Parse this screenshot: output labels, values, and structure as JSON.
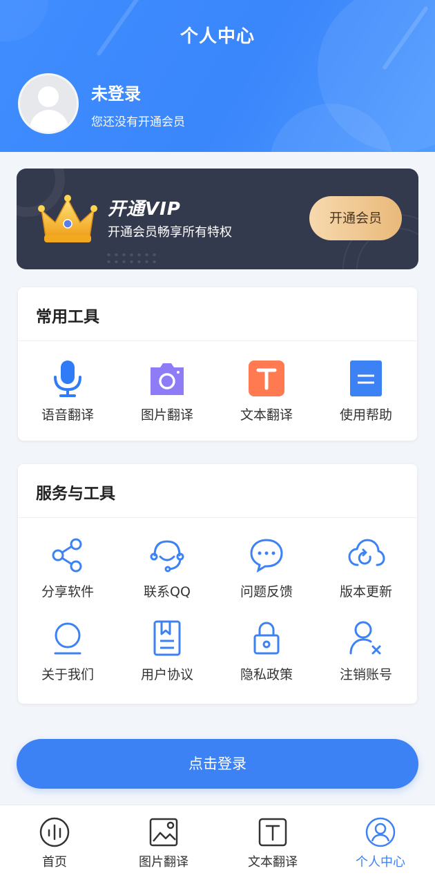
{
  "header": {
    "title": "个人中心",
    "user": {
      "name": "未登录",
      "subtitle": "您还没有开通会员"
    }
  },
  "vip": {
    "title": "开通VIP",
    "subtitle": "开通会员畅享所有特权",
    "button": "开通会员"
  },
  "common_tools": {
    "title": "常用工具",
    "items": [
      {
        "label": "语音翻译",
        "icon": "microphone-icon"
      },
      {
        "label": "图片翻译",
        "icon": "camera-icon"
      },
      {
        "label": "文本翻译",
        "icon": "text-t-icon"
      },
      {
        "label": "使用帮助",
        "icon": "document-icon"
      }
    ]
  },
  "services": {
    "title": "服务与工具",
    "items": [
      {
        "label": "分享软件",
        "icon": "share-icon"
      },
      {
        "label": "联系QQ",
        "icon": "headset-icon"
      },
      {
        "label": "问题反馈",
        "icon": "chat-bubble-icon"
      },
      {
        "label": "版本更新",
        "icon": "cloud-refresh-icon"
      },
      {
        "label": "关于我们",
        "icon": "info-icon"
      },
      {
        "label": "用户协议",
        "icon": "agreement-icon"
      },
      {
        "label": "隐私政策",
        "icon": "lock-icon"
      },
      {
        "label": "注销账号",
        "icon": "user-remove-icon"
      }
    ]
  },
  "login_button": "点击登录",
  "bottom_nav": {
    "items": [
      {
        "label": "首页",
        "icon": "home-audio-icon",
        "active": false
      },
      {
        "label": "图片翻译",
        "icon": "image-icon",
        "active": false
      },
      {
        "label": "文本翻译",
        "icon": "text-t-icon",
        "active": false
      },
      {
        "label": "个人中心",
        "icon": "profile-icon",
        "active": true
      }
    ]
  },
  "colors": {
    "primary": "#3c82f5",
    "vip_bg": "#343a4d",
    "vip_button": "#e9b97a",
    "mic_blue": "#2f7cf6",
    "camera_purple": "#8d7cf5",
    "text_orange": "#ff7a50",
    "doc_blue": "#3c82f5"
  }
}
